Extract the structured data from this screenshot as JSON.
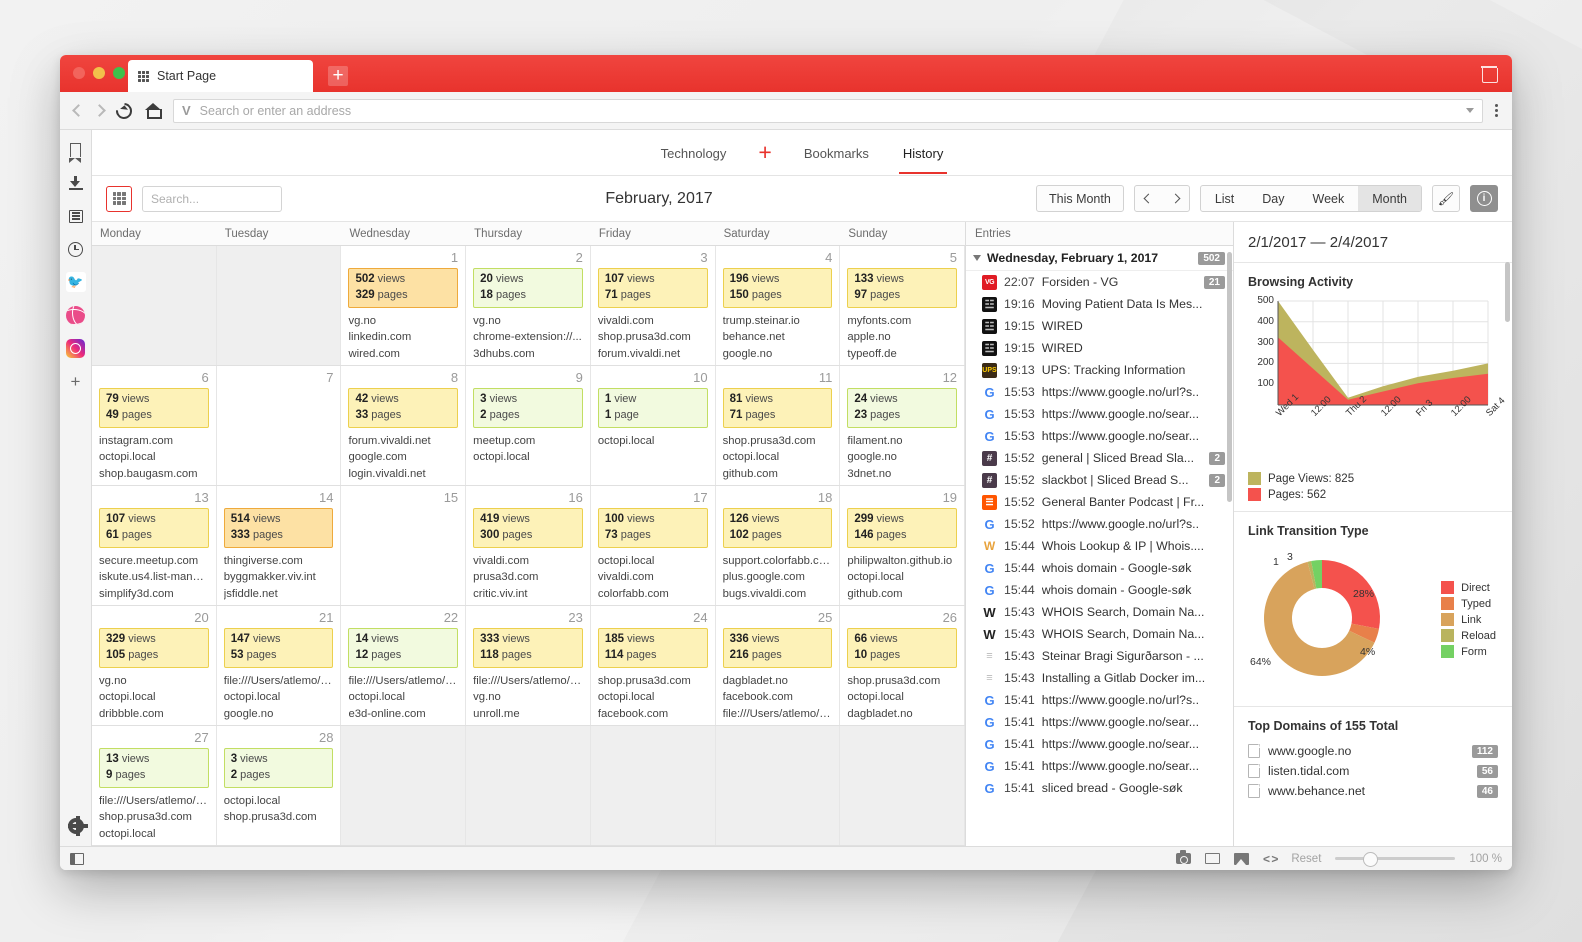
{
  "window": {
    "tab_title": "Start Page",
    "address_placeholder": "Search or enter an address"
  },
  "sidebar": {
    "items": [
      {
        "name": "bookmarks",
        "icon": "bookmark-icon"
      },
      {
        "name": "downloads",
        "icon": "download-icon"
      },
      {
        "name": "notes",
        "icon": "notes-icon"
      },
      {
        "name": "history",
        "icon": "clock-icon"
      },
      {
        "name": "twitter",
        "icon": "twitter-icon"
      },
      {
        "name": "dribbble",
        "icon": "dribbble-icon"
      },
      {
        "name": "instagram",
        "icon": "instagram-icon"
      },
      {
        "name": "add-panel",
        "icon": "plus-icon"
      }
    ],
    "settings_label": "gear-icon"
  },
  "page_tabs": [
    {
      "label": "Technology",
      "active": false
    },
    {
      "label": "Bookmarks",
      "active": false
    },
    {
      "label": "History",
      "active": true
    }
  ],
  "page_tab_plus": "+",
  "toolbar": {
    "search_placeholder": "Search...",
    "month_label": "February, 2017",
    "this_month_label": "This Month",
    "views": [
      "List",
      "Day",
      "Week",
      "Month"
    ],
    "active_view": "Month"
  },
  "calendar": {
    "weekdays": [
      "Monday",
      "Tuesday",
      "Wednesday",
      "Thursday",
      "Friday",
      "Saturday",
      "Sunday"
    ],
    "weeks": [
      [
        {
          "empty": true
        },
        {
          "empty": true
        },
        {
          "day": "1",
          "views": "502",
          "views_label": "views",
          "pages": "329",
          "pages_label": "pages",
          "level": 3,
          "sites": [
            "vg.no",
            "linkedin.com",
            "wired.com"
          ]
        },
        {
          "day": "2",
          "views": "20",
          "views_label": "views",
          "pages": "18",
          "pages_label": "pages",
          "level": 1,
          "sites": [
            "vg.no",
            "chrome-extension://...",
            "3dhubs.com"
          ]
        },
        {
          "day": "3",
          "views": "107",
          "views_label": "views",
          "pages": "71",
          "pages_label": "pages",
          "level": 2,
          "sites": [
            "vivaldi.com",
            "shop.prusa3d.com",
            "forum.vivaldi.net"
          ]
        },
        {
          "day": "4",
          "views": "196",
          "views_label": "views",
          "pages": "150",
          "pages_label": "pages",
          "level": 2,
          "sites": [
            "trump.steinar.io",
            "behance.net",
            "google.no"
          ]
        },
        {
          "day": "5",
          "views": "133",
          "views_label": "views",
          "pages": "97",
          "pages_label": "pages",
          "level": 2,
          "sites": [
            "myfonts.com",
            "apple.no",
            "typeoff.de"
          ]
        }
      ],
      [
        {
          "day": "6",
          "views": "79",
          "views_label": "views",
          "pages": "49",
          "pages_label": "pages",
          "level": 2,
          "sites": [
            "instagram.com",
            "octopi.local",
            "shop.baugasm.com"
          ]
        },
        {
          "day": "7",
          "sites": []
        },
        {
          "day": "8",
          "views": "42",
          "views_label": "views",
          "pages": "33",
          "pages_label": "pages",
          "level": 2,
          "sites": [
            "forum.vivaldi.net",
            "google.com",
            "login.vivaldi.net"
          ]
        },
        {
          "day": "9",
          "views": "3",
          "views_label": "views",
          "pages": "2",
          "pages_label": "pages",
          "level": 1,
          "sites": [
            "meetup.com",
            "octopi.local"
          ]
        },
        {
          "day": "10",
          "views": "1",
          "views_label": "view",
          "pages": "1",
          "pages_label": "page",
          "level": 1,
          "sites": [
            "octopi.local"
          ]
        },
        {
          "day": "11",
          "views": "81",
          "views_label": "views",
          "pages": "71",
          "pages_label": "pages",
          "level": 2,
          "sites": [
            "shop.prusa3d.com",
            "octopi.local",
            "github.com"
          ]
        },
        {
          "day": "12",
          "views": "24",
          "views_label": "views",
          "pages": "23",
          "pages_label": "pages",
          "level": 1,
          "sites": [
            "filament.no",
            "google.no",
            "3dnet.no"
          ]
        }
      ],
      [
        {
          "day": "13",
          "views": "107",
          "views_label": "views",
          "pages": "61",
          "pages_label": "pages",
          "level": 2,
          "sites": [
            "secure.meetup.com",
            "iskute.us4.list-manag..",
            "simplify3d.com"
          ]
        },
        {
          "day": "14",
          "views": "514",
          "views_label": "views",
          "pages": "333",
          "pages_label": "pages",
          "level": 3,
          "sites": [
            "thingiverse.com",
            "byggmakker.viv.int",
            "jsfiddle.net"
          ]
        },
        {
          "day": "15",
          "sites": []
        },
        {
          "day": "16",
          "views": "419",
          "views_label": "views",
          "pages": "300",
          "pages_label": "pages",
          "level": 2,
          "sites": [
            "vivaldi.com",
            "prusa3d.com",
            "critic.viv.int"
          ]
        },
        {
          "day": "17",
          "views": "100",
          "views_label": "views",
          "pages": "73",
          "pages_label": "pages",
          "level": 2,
          "sites": [
            "octopi.local",
            "vivaldi.com",
            "colorfabb.com"
          ]
        },
        {
          "day": "18",
          "views": "126",
          "views_label": "views",
          "pages": "102",
          "pages_label": "pages",
          "level": 2,
          "sites": [
            "support.colorfabb.co...",
            "plus.google.com",
            "bugs.vivaldi.com"
          ]
        },
        {
          "day": "19",
          "views": "299",
          "views_label": "views",
          "pages": "146",
          "pages_label": "pages",
          "level": 2,
          "sites": [
            "philipwalton.github.io",
            "octopi.local",
            "github.com"
          ]
        }
      ],
      [
        {
          "day": "20",
          "views": "329",
          "views_label": "views",
          "pages": "105",
          "pages_label": "pages",
          "level": 2,
          "sites": [
            "vg.no",
            "octopi.local",
            "dribbble.com"
          ]
        },
        {
          "day": "21",
          "views": "147",
          "views_label": "views",
          "pages": "53",
          "pages_label": "pages",
          "level": 2,
          "sites": [
            "file:///Users/atlemo/D...",
            "octopi.local",
            "google.no"
          ]
        },
        {
          "day": "22",
          "views": "14",
          "views_label": "views",
          "pages": "12",
          "pages_label": "pages",
          "level": 1,
          "sites": [
            "file:///Users/atlemo/D...",
            "octopi.local",
            "e3d-online.com"
          ]
        },
        {
          "day": "23",
          "views": "333",
          "views_label": "views",
          "pages": "118",
          "pages_label": "pages",
          "level": 2,
          "sites": [
            "file:///Users/atlemo/D...",
            "vg.no",
            "unroll.me"
          ]
        },
        {
          "day": "24",
          "views": "185",
          "views_label": "views",
          "pages": "114",
          "pages_label": "pages",
          "level": 2,
          "sites": [
            "shop.prusa3d.com",
            "octopi.local",
            "facebook.com"
          ]
        },
        {
          "day": "25",
          "views": "336",
          "views_label": "views",
          "pages": "216",
          "pages_label": "pages",
          "level": 2,
          "sites": [
            "dagbladet.no",
            "facebook.com",
            "file:///Users/atlemo/D..."
          ]
        },
        {
          "day": "26",
          "views": "66",
          "views_label": "views",
          "pages": "10",
          "pages_label": "pages",
          "level": 2,
          "sites": [
            "shop.prusa3d.com",
            "octopi.local",
            "dagbladet.no"
          ]
        }
      ],
      [
        {
          "day": "27",
          "views": "13",
          "views_label": "views",
          "pages": "9",
          "pages_label": "pages",
          "level": 1,
          "sites": [
            "file:///Users/atlemo/D...",
            "shop.prusa3d.com",
            "octopi.local"
          ]
        },
        {
          "day": "28",
          "views": "3",
          "views_label": "views",
          "pages": "2",
          "pages_label": "pages",
          "level": 1,
          "sites": [
            "octopi.local",
            "shop.prusa3d.com"
          ]
        },
        {
          "empty": true
        },
        {
          "empty": true
        },
        {
          "empty": true
        },
        {
          "empty": true
        },
        {
          "empty": true
        }
      ]
    ]
  },
  "entries": {
    "header": "Entries",
    "group_label": "Wednesday, February 1, 2017",
    "group_badge": "502",
    "rows": [
      {
        "icon": "vg",
        "time": "22:07",
        "title": "Forsiden - VG",
        "badge": "21"
      },
      {
        "icon": "wired",
        "time": "19:16",
        "title": "Moving Patient Data Is Mes..."
      },
      {
        "icon": "wired",
        "time": "19:15",
        "title": "WIRED"
      },
      {
        "icon": "wired",
        "time": "19:15",
        "title": "WIRED"
      },
      {
        "icon": "ups",
        "time": "19:13",
        "title": "UPS: Tracking Information"
      },
      {
        "icon": "google",
        "time": "15:53",
        "title": "https://www.google.no/url?s.."
      },
      {
        "icon": "google",
        "time": "15:53",
        "title": "https://www.google.no/sear..."
      },
      {
        "icon": "google",
        "time": "15:53",
        "title": "https://www.google.no/sear..."
      },
      {
        "icon": "slack",
        "time": "15:52",
        "title": "general | Sliced Bread Sla...",
        "badge": "2"
      },
      {
        "icon": "slack",
        "time": "15:52",
        "title": "slackbot | Sliced Bread S...",
        "badge": "2"
      },
      {
        "icon": "soundcloud",
        "time": "15:52",
        "title": "General Banter Podcast | Fr..."
      },
      {
        "icon": "google",
        "time": "15:52",
        "title": "https://www.google.no/url?s.."
      },
      {
        "icon": "whois",
        "time": "15:44",
        "title": "Whois Lookup & IP | Whois...."
      },
      {
        "icon": "google",
        "time": "15:44",
        "title": "whois domain - Google-søk"
      },
      {
        "icon": "google",
        "time": "15:44",
        "title": "whois domain - Google-søk"
      },
      {
        "icon": "whois2",
        "time": "15:43",
        "title": "WHOIS Search, Domain Na..."
      },
      {
        "icon": "whois2",
        "time": "15:43",
        "title": "WHOIS Search, Domain Na..."
      },
      {
        "icon": "doc",
        "time": "15:43",
        "title": "Steinar Bragi Sigurðarson - ..."
      },
      {
        "icon": "doc",
        "time": "15:43",
        "title": "Installing a Gitlab Docker im..."
      },
      {
        "icon": "google",
        "time": "15:41",
        "title": "https://www.google.no/url?s.."
      },
      {
        "icon": "google",
        "time": "15:41",
        "title": "https://www.google.no/sear..."
      },
      {
        "icon": "google",
        "time": "15:41",
        "title": "https://www.google.no/sear..."
      },
      {
        "icon": "google",
        "time": "15:41",
        "title": "https://www.google.no/sear..."
      },
      {
        "icon": "google",
        "time": "15:41",
        "title": "sliced bread - Google-søk"
      }
    ]
  },
  "stats": {
    "range": "2/1/2017 — 2/4/2017",
    "browsing_title": "Browsing Activity",
    "transition_title": "Link Transition Type",
    "domains_title": "Top Domains of 155 Total",
    "domains": [
      {
        "name": "www.google.no",
        "count": "112"
      },
      {
        "name": "listen.tidal.com",
        "count": "56"
      },
      {
        "name": "www.behance.net",
        "count": "46"
      }
    ]
  },
  "chart_data": [
    {
      "type": "area",
      "title": "Browsing Activity",
      "xlabel": "",
      "ylabel": "",
      "ylim": [
        0,
        500
      ],
      "yticks": [
        100,
        200,
        300,
        400,
        500
      ],
      "x": [
        "Wed 1",
        "12:00",
        "Thu 2",
        "12:00",
        "Fri 3",
        "12:00",
        "Sat 4"
      ],
      "grid": true,
      "legend_position": "bottom",
      "series": [
        {
          "name": "Page Views: 825",
          "color": "#bdb45e",
          "values": [
            500,
            265,
            35,
            90,
            135,
            165,
            200
          ]
        },
        {
          "name": "Pages: 562",
          "color": "#f4524d",
          "values": [
            325,
            175,
            25,
            65,
            105,
            130,
            150
          ]
        }
      ]
    },
    {
      "type": "pie",
      "title": "Link Transition Type",
      "labels": [
        "Direct",
        "Typed",
        "Link",
        "Reload",
        "Form"
      ],
      "values": [
        28,
        4,
        64,
        1,
        3
      ],
      "display_labels": [
        "28%",
        "4%",
        "64%",
        "1",
        "3"
      ],
      "colors": [
        "#f4524d",
        "#e8804a",
        "#d8a35c",
        "#b9b45e",
        "#74d163"
      ],
      "legend_position": "right",
      "donut": true
    }
  ],
  "statusbar": {
    "reset_label": "Reset",
    "zoom_label": "100 %"
  }
}
